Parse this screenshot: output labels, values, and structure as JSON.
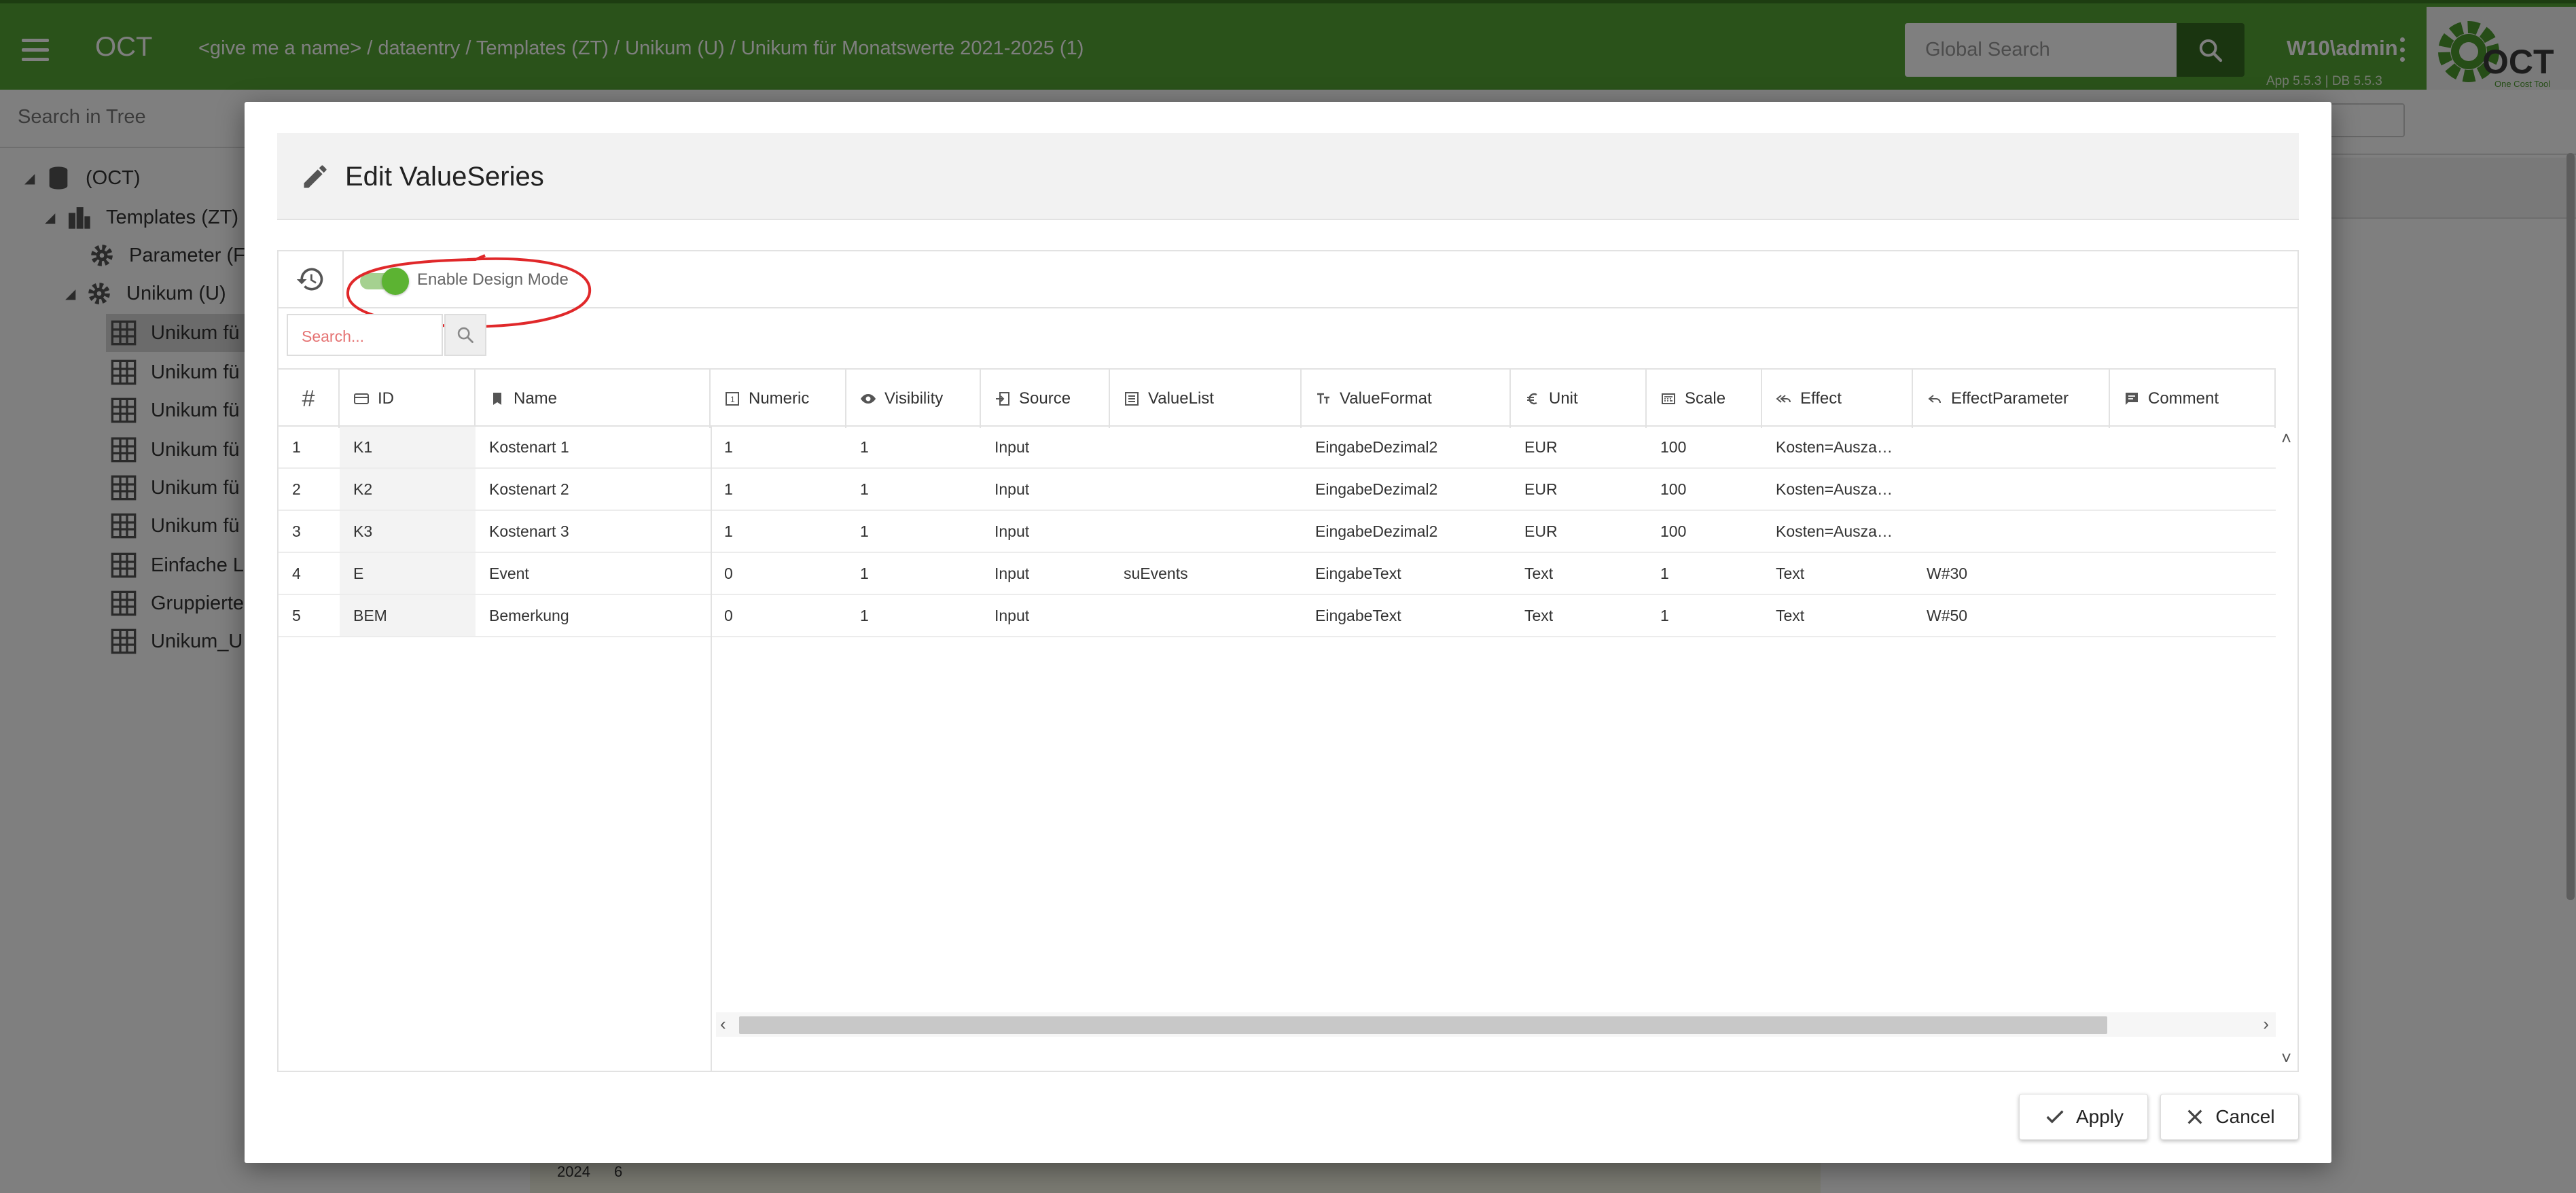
{
  "app": {
    "name": "OCT",
    "breadcrumb": "<give me a name> / dataentry / Templates (ZT) / Unikum (U) / Unikum für Monatswerte 2021-2025 (1)",
    "search_placeholder": "Global Search",
    "user": "W10\\admin",
    "version": "App 5.5.3 | DB 5.5.3",
    "logo_text": "OCT",
    "logo_tagline": "One Cost Tool",
    "brand_color": "#55a435"
  },
  "tree": {
    "search_placeholder": "Search in Tree",
    "nodes": [
      {
        "label": "(OCT)"
      },
      {
        "label": "Templates (ZT)"
      },
      {
        "label": "Parameter (F"
      },
      {
        "label": "Unikum (U)"
      },
      {
        "label": "Unikum fü"
      },
      {
        "label": "Unikum fü"
      },
      {
        "label": "Unikum fü"
      },
      {
        "label": "Unikum fü"
      },
      {
        "label": "Unikum fü"
      },
      {
        "label": "Unikum fü"
      },
      {
        "label": "Einfache L"
      },
      {
        "label": "Gruppierte"
      },
      {
        "label": "Unikum_U"
      }
    ]
  },
  "background": {
    "year_label": "2024",
    "year_value": "6"
  },
  "dialog": {
    "title": "Edit ValueSeries",
    "design_mode_label": "Enable Design Mode",
    "search_placeholder": "Search...",
    "columns": {
      "num": "#",
      "id": "ID",
      "name": "Name",
      "numeric": "Numeric",
      "visibility": "Visibility",
      "source": "Source",
      "valuelist": "ValueList",
      "valueformat": "ValueFormat",
      "unit": "Unit",
      "scale": "Scale",
      "effect": "Effect",
      "effectparam": "EffectParameter",
      "comment": "Comment"
    },
    "rows": [
      {
        "num": "1",
        "id": "K1",
        "name": "Kostenart 1",
        "numeric": "1",
        "visibility": "1",
        "source": "Input",
        "valuelist": "",
        "valueformat": "EingabeDezimal2",
        "unit": "EUR",
        "scale": "100",
        "effect": "Kosten=Ausza…",
        "effectparam": "",
        "comment": ""
      },
      {
        "num": "2",
        "id": "K2",
        "name": "Kostenart 2",
        "numeric": "1",
        "visibility": "1",
        "source": "Input",
        "valuelist": "",
        "valueformat": "EingabeDezimal2",
        "unit": "EUR",
        "scale": "100",
        "effect": "Kosten=Ausza…",
        "effectparam": "",
        "comment": ""
      },
      {
        "num": "3",
        "id": "K3",
        "name": "Kostenart 3",
        "numeric": "1",
        "visibility": "1",
        "source": "Input",
        "valuelist": "",
        "valueformat": "EingabeDezimal2",
        "unit": "EUR",
        "scale": "100",
        "effect": "Kosten=Ausza…",
        "effectparam": "",
        "comment": ""
      },
      {
        "num": "4",
        "id": "E",
        "name": "Event",
        "numeric": "0",
        "visibility": "1",
        "source": "Input",
        "valuelist": "suEvents",
        "valueformat": "EingabeText",
        "unit": "Text",
        "scale": "1",
        "effect": "Text",
        "effectparam": "W#30",
        "comment": ""
      },
      {
        "num": "5",
        "id": "BEM",
        "name": "Bemerkung",
        "numeric": "0",
        "visibility": "1",
        "source": "Input",
        "valuelist": "",
        "valueformat": "EingabeText",
        "unit": "Text",
        "scale": "1",
        "effect": "Text",
        "effectparam": "W#50",
        "comment": ""
      }
    ],
    "apply_label": "Apply",
    "cancel_label": "Cancel",
    "annotation_color": "#e0282a"
  }
}
